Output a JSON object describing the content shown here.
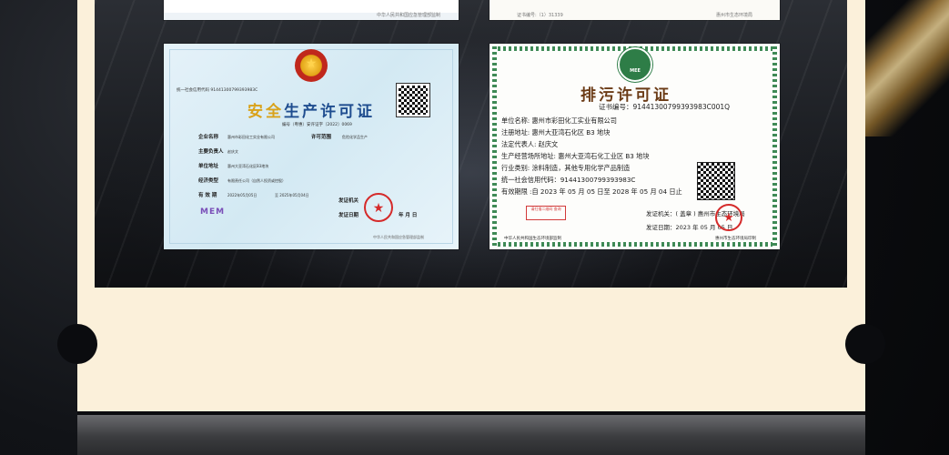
{
  "top_left_cert": {
    "footer": "中华人民共和国应急管理部监制"
  },
  "top_right_cert": {
    "cert_no_label": "证书编号:（1）31339",
    "footer": "惠州市生态环境局"
  },
  "safety_license": {
    "code": "统一社会信用代码 91441300799393983C",
    "title_gold": "安全",
    "title_rest": "生产许可证",
    "number": "编号（粤惠）安许证字〔2022〕0069",
    "fields": [
      {
        "label": "企业名称",
        "value": "惠州市彩田化工实业有限公司"
      },
      {
        "label": "主要负责人",
        "value": "赵庆文"
      },
      {
        "label": "单位地址",
        "value": "惠州大亚湾石化区B3地块"
      },
      {
        "label": "经济类型",
        "value": "有限责任公司（自然人投资或控股）"
      },
      {
        "label": "有 效 期",
        "value": "2022年05月05日"
      }
    ],
    "until": "至 2025年05月04日",
    "scope_label": "许可范围",
    "scope_value": "危险化学品生产",
    "issuer_label": "发证机关",
    "issue_date_label": "发证日期",
    "issue_ym": "年  月  日",
    "mem": "MEM",
    "footer": "中华人民共和国应急管理部监制"
  },
  "pollution_license": {
    "logo_text": "MEE",
    "title": "排污许可证",
    "cert_no": "证书编号：91441300799393983C001Q",
    "lines": [
      "单位名称: 惠州市彩田化工实业有限公司",
      "注册地址: 惠州大亚湾石化区 B3 地块",
      "法定代表人: 赵庆文",
      "生产经营场所地址: 惠州大亚湾石化工业区 B3 地块",
      "行业类别: 涂料制造，其他专用化学产品制造",
      "统一社会信用代码：91441300799393983C",
      " 有效期限 :自 2023 年 05 月 05 日至 2028 年 05 月 04 日止"
    ],
    "stamp_box": "请扫描二维码 查询",
    "issuer": "发证机关：( 盖章 ) 惠州市生态环境局",
    "issue_date": "发证日期：2023 年 05 月 05 日",
    "footer_left": "中华人民共和国生态环境部监制",
    "footer_right": "惠州市生态环境局印制"
  }
}
